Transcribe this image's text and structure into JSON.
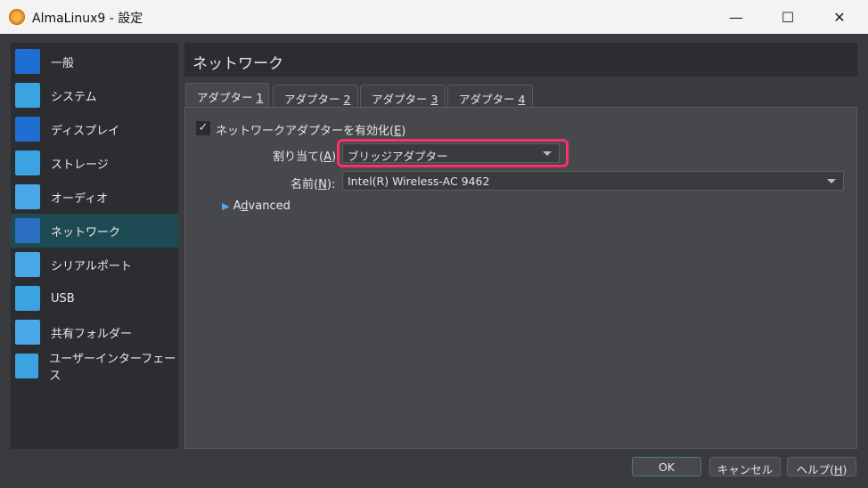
{
  "window": {
    "title": "AlmaLinux9 - 設定",
    "minimize": "—",
    "maximize": "☐",
    "close": "✕"
  },
  "sidebar": {
    "items": [
      {
        "label": "一般",
        "icon": "monitor-icon",
        "color": "#1e6fd1"
      },
      {
        "label": "システム",
        "icon": "chip-icon",
        "color": "#3aa3e0"
      },
      {
        "label": "ディスプレイ",
        "icon": "display-icon",
        "color": "#1e6fd1"
      },
      {
        "label": "ストレージ",
        "icon": "disk-icon",
        "color": "#3aa3e0"
      },
      {
        "label": "オーディオ",
        "icon": "speaker-icon",
        "color": "#4aa8e8"
      },
      {
        "label": "ネットワーク",
        "icon": "network-icon",
        "color": "#2a6fc0"
      },
      {
        "label": "シリアルポート",
        "icon": "serial-port-icon",
        "color": "#4aa8e8"
      },
      {
        "label": "USB",
        "icon": "usb-icon",
        "color": "#3aa3e0"
      },
      {
        "label": "共有フォルダー",
        "icon": "folder-icon",
        "color": "#4aa8e8"
      },
      {
        "label": "ユーザーインターフェース",
        "icon": "ui-icon",
        "color": "#3aa3e0"
      }
    ],
    "selected": 5
  },
  "header": {
    "title": "ネットワーク"
  },
  "tabs": [
    {
      "label": "アダプター ",
      "key": "1"
    },
    {
      "label": "アダプター ",
      "key": "2"
    },
    {
      "label": "アダプター ",
      "key": "3"
    },
    {
      "label": "アダプター ",
      "key": "4"
    }
  ],
  "form": {
    "enable_label": "ネットワークアダプターを有効化(",
    "enable_key": "E",
    "enable_end": ")",
    "enabled": true,
    "attached_label": "割り当て(",
    "attached_key": "A",
    "attached_end": "):",
    "attached_value": "ブリッジアダプター",
    "name_label": "名前(",
    "name_key": "N",
    "name_end": "):",
    "name_value": "Intel(R) Wireless-AC 9462",
    "advanced_pre": "A",
    "advanced_key": "d",
    "advanced_post": "vanced"
  },
  "buttons": {
    "ok": "OK",
    "cancel": "キャンセル",
    "help_pre": "ヘルプ(",
    "help_key": "H",
    "help_end": ")"
  }
}
